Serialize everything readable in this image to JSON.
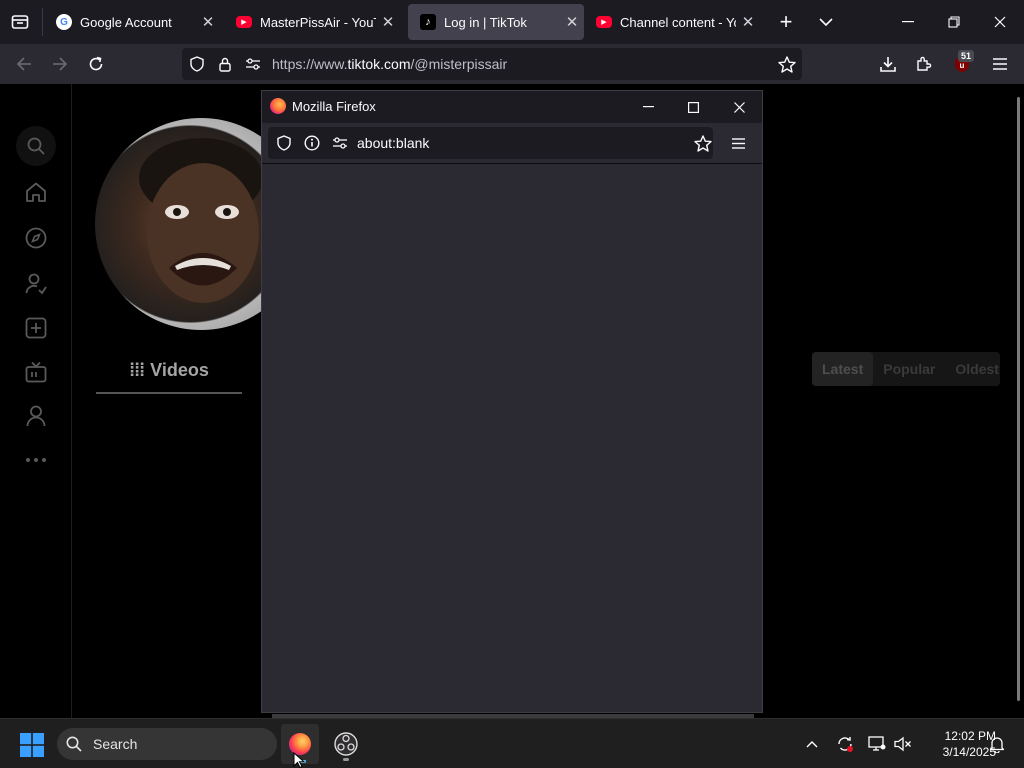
{
  "browser": {
    "tabs": [
      {
        "title": "Google Account",
        "favicon": "google-icon",
        "active": false
      },
      {
        "title": "MasterPissAir - YouTub",
        "favicon": "youtube-icon",
        "active": false
      },
      {
        "title": "Log in | TikTok",
        "favicon": "tiktok-icon",
        "active": true
      },
      {
        "title": "Channel content - YouT",
        "favicon": "youtube-icon",
        "active": false
      }
    ],
    "url_prefix": "https://www.",
    "url_domain": "tiktok.com",
    "url_path": "/@misterpissair",
    "extension_badge": "51"
  },
  "page": {
    "videos_tab_label": "Videos",
    "sort_options": [
      "Latest",
      "Popular",
      "Oldest"
    ],
    "sort_active": "Latest",
    "nav_icons": [
      "search-icon",
      "home-icon",
      "explore-icon",
      "following-icon",
      "upload-icon",
      "live-icon",
      "profile-icon",
      "more-icon"
    ]
  },
  "popup": {
    "window_title": "Mozilla Firefox",
    "url": "about:blank"
  },
  "taskbar": {
    "search_placeholder": "Search",
    "time": "12:02 PM",
    "date": "3/14/2025"
  },
  "colors": {
    "firefox_dark": "#1c1b22",
    "firefox_toolbar": "#2b2a33",
    "youtube_red": "#ff0033",
    "windows_blue": "#0a84ff"
  }
}
